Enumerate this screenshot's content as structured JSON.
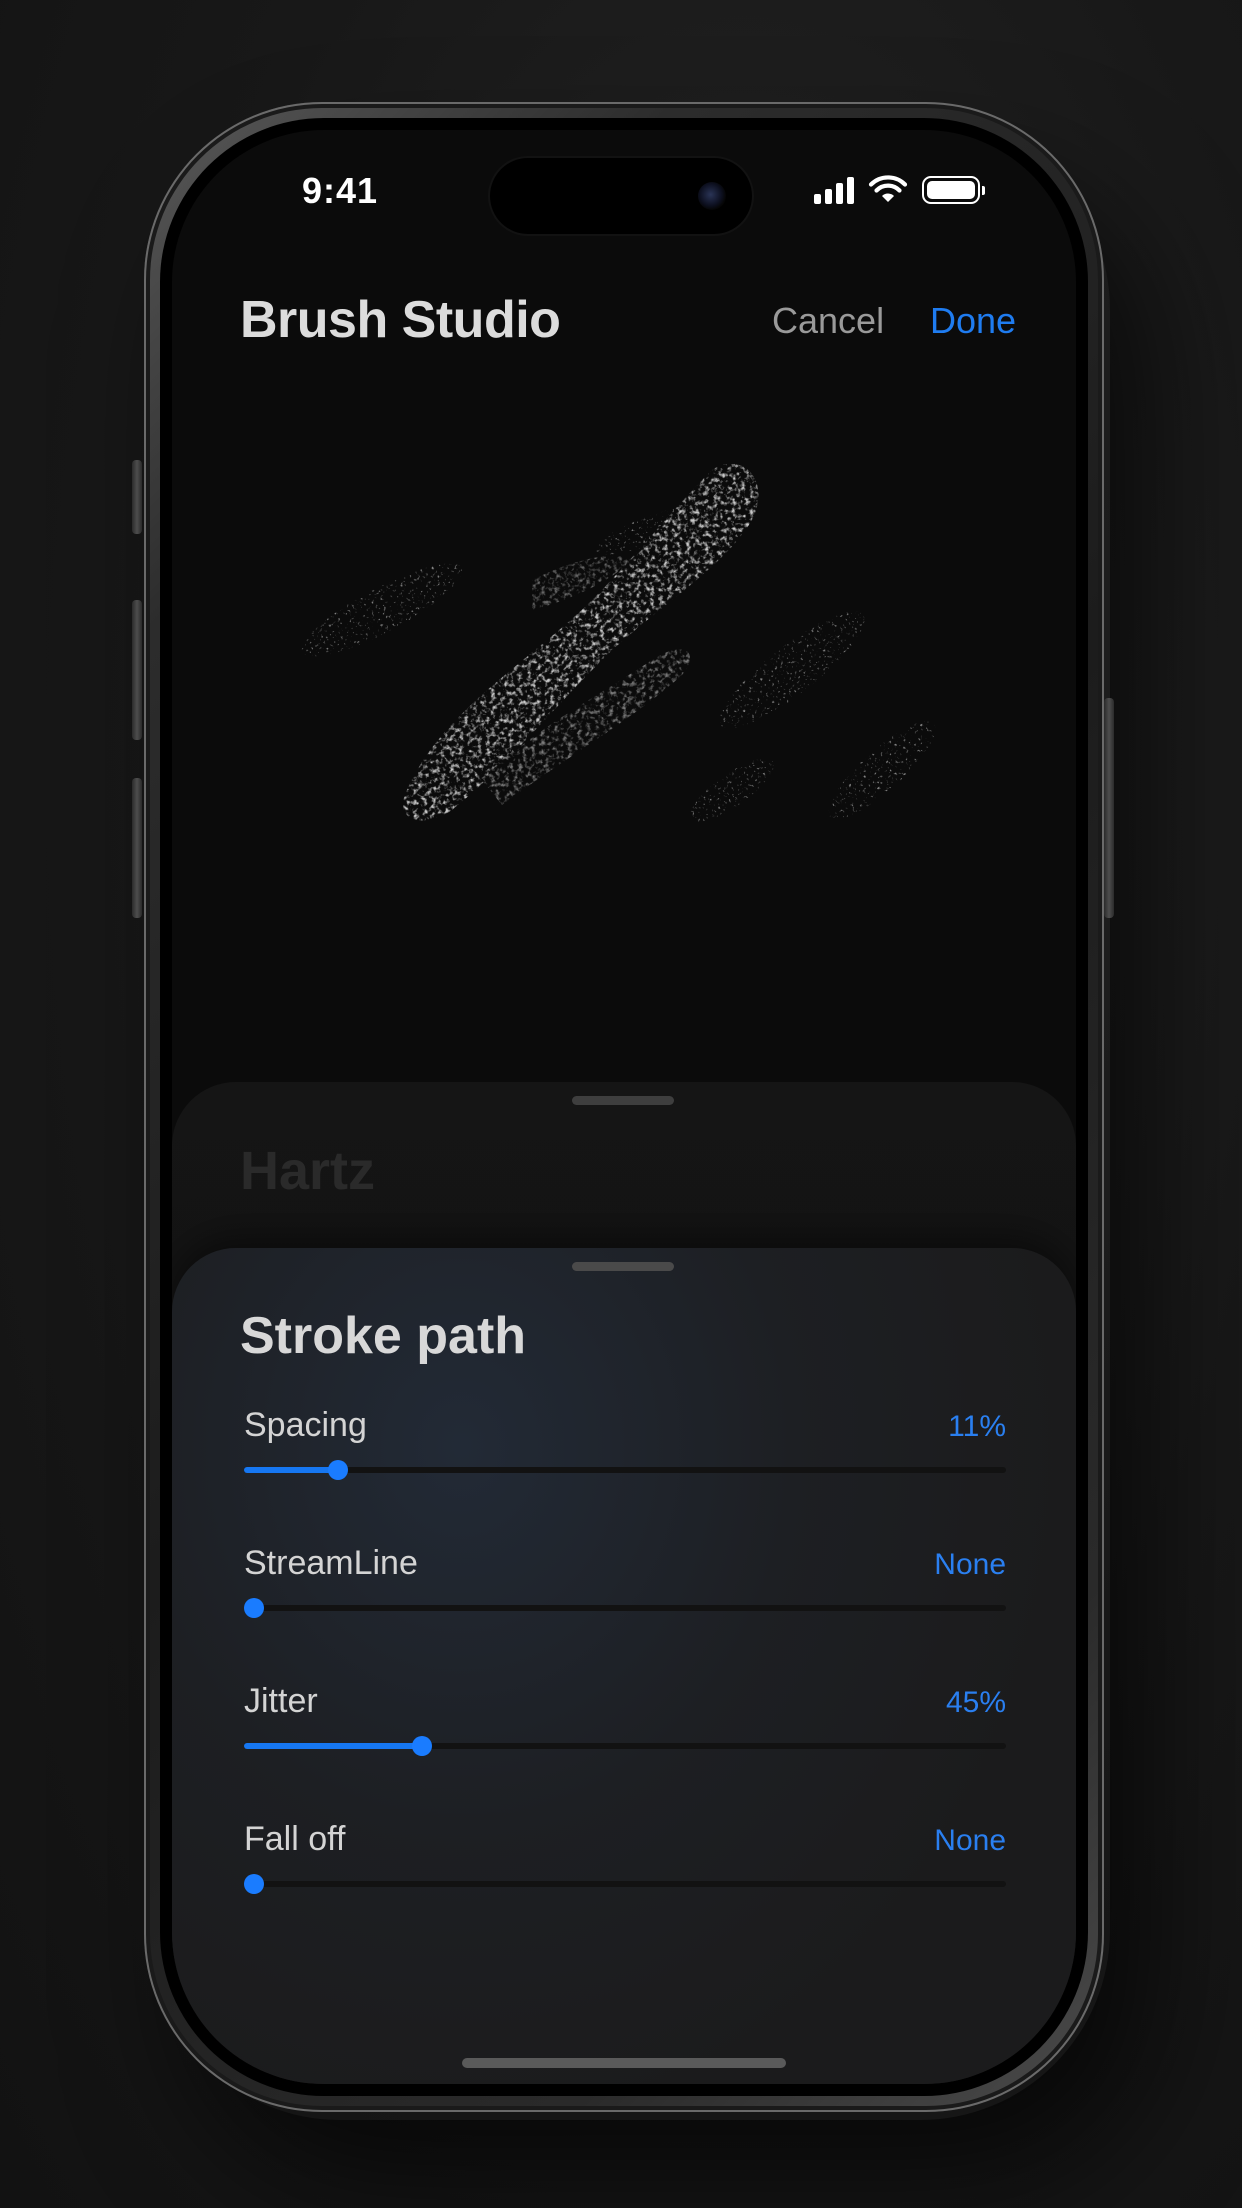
{
  "status_bar": {
    "time": "9:41",
    "icons": [
      "signal-icon",
      "wifi-icon",
      "battery-icon"
    ]
  },
  "nav": {
    "title": "Brush Studio",
    "cancel_label": "Cancel",
    "done_label": "Done"
  },
  "brush": {
    "name": "Hartz"
  },
  "panel": {
    "title": "Stroke path",
    "sliders": [
      {
        "label": "Spacing",
        "value_text": "11%",
        "fraction": 0.11
      },
      {
        "label": "StreamLine",
        "value_text": "None",
        "fraction": 0
      },
      {
        "label": "Jitter",
        "value_text": "45%",
        "fraction": 0.22
      },
      {
        "label": "Fall off",
        "value_text": "None",
        "fraction": 0
      }
    ]
  },
  "colors": {
    "accent": "#1f7cf0",
    "background": "#0b0b0b",
    "sheet": "#1d1f23"
  }
}
